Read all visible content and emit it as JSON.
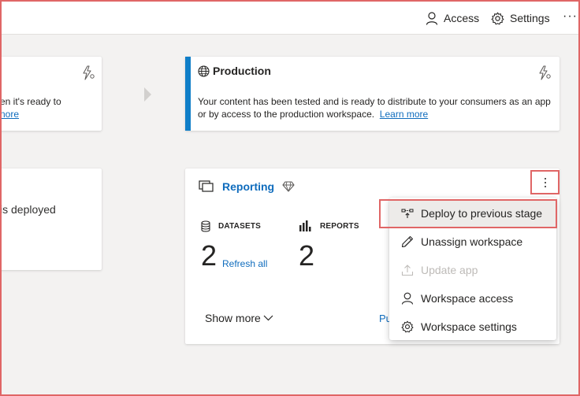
{
  "topbar": {
    "access_label": "Access",
    "settings_label": "Settings",
    "more_label": "···"
  },
  "left_top_card": {
    "text_line1": "en it's ready to",
    "link": "nore"
  },
  "production": {
    "title": "Production",
    "description": "Your content has been tested and is ready to distribute to your consumers as an app or by access to the production workspace.",
    "link": "Learn more",
    "accent_color": "#0f7ec8"
  },
  "left_bottom_card": {
    "text": "is deployed"
  },
  "reporting": {
    "workspace_name": "Reporting",
    "datasets_label": "DATASETS",
    "datasets_count": "2",
    "refresh_all": "Refresh all",
    "reports_label": "REPORTS",
    "reports_count": "2",
    "show_more": "Show more",
    "truncated_link": "Pu"
  },
  "menu": {
    "items": [
      {
        "label": "Deploy to previous stage",
        "icon": "deploy-icon",
        "state": "highlighted"
      },
      {
        "label": "Unassign workspace",
        "icon": "pencil-icon",
        "state": "enabled"
      },
      {
        "label": "Update app",
        "icon": "upload-icon",
        "state": "disabled"
      },
      {
        "label": "Workspace access",
        "icon": "person-icon",
        "state": "enabled"
      },
      {
        "label": "Workspace settings",
        "icon": "gear-icon",
        "state": "enabled"
      }
    ]
  },
  "colors": {
    "link": "#0f6cbd",
    "annotation_red": "#e06666",
    "disabled_text": "#bebbb8"
  }
}
